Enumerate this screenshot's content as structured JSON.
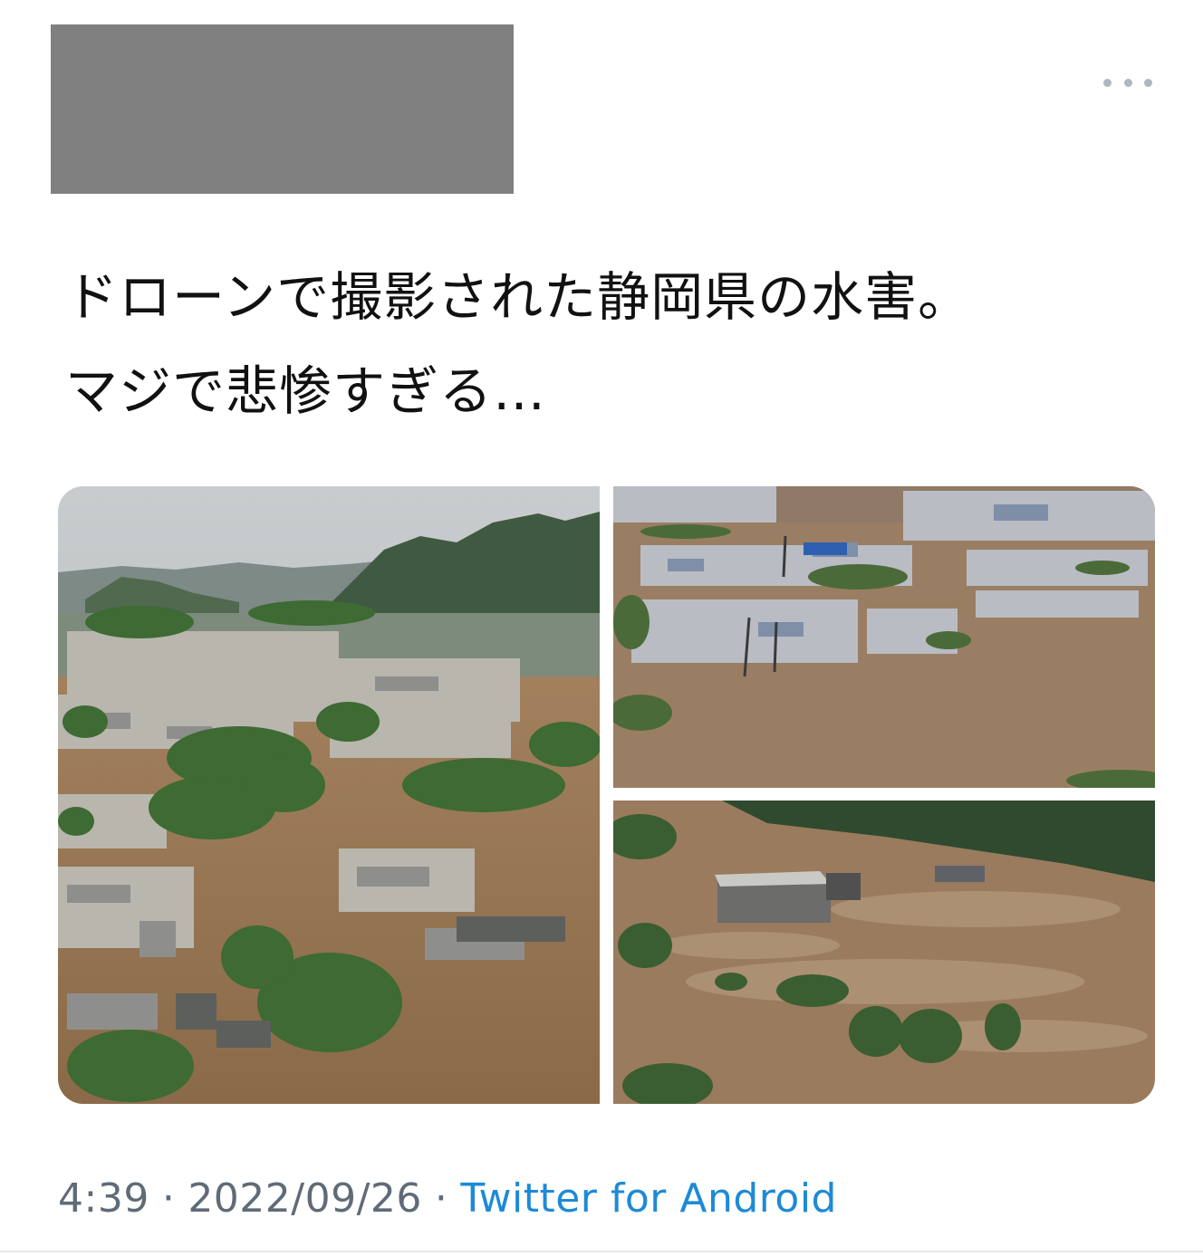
{
  "tweet": {
    "text_line_1": "ドローンで撮影された静岡県の水害。",
    "text_line_2": "マジで悲惨すぎる…"
  },
  "header": {
    "more_icon": "more-horizontal-icon"
  },
  "media": {
    "photos": [
      {
        "name": "flooded-town-mountains-photo"
      },
      {
        "name": "flooded-neighborhood-photo"
      },
      {
        "name": "flood-river-building-photo"
      }
    ]
  },
  "meta": {
    "time": "4:39",
    "separator": "·",
    "date": "2022/09/26",
    "source": "Twitter for Android"
  },
  "colors": {
    "link": "#1d8ad6",
    "meta_text": "#5f6b77",
    "redaction": "#808080"
  }
}
